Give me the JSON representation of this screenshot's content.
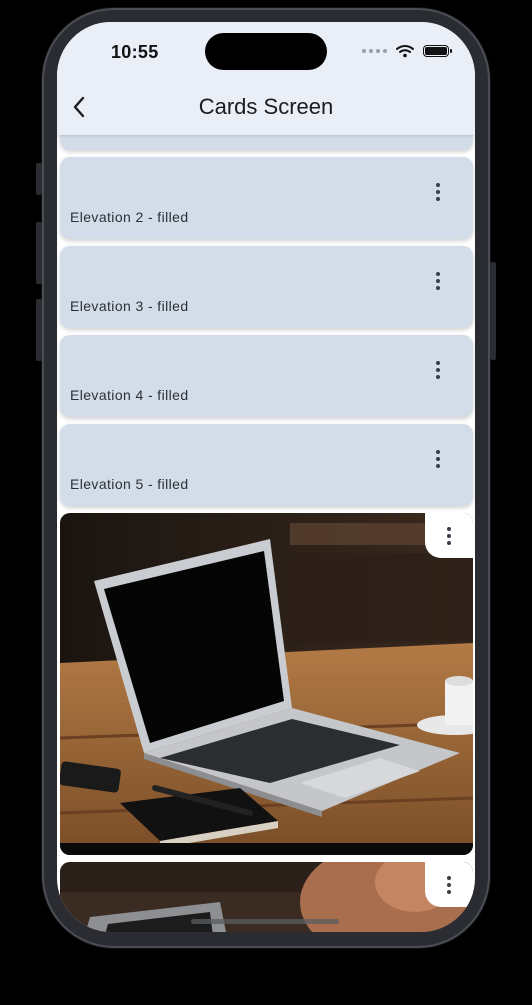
{
  "status_bar": {
    "time": "10:55"
  },
  "app_bar": {
    "title": "Cards Screen",
    "back_icon": "chevron-left-icon"
  },
  "cards": [
    {
      "label": "Elevation 2 - filled"
    },
    {
      "label": "Elevation 3 - filled"
    },
    {
      "label": "Elevation 4 - filled"
    },
    {
      "label": "Elevation 5 - filled"
    }
  ],
  "image_cards": [
    {
      "image": "laptop-on-wooden-table-photo",
      "menu_icon": "more-vert-icon"
    },
    {
      "image": "laptop-photo-partial",
      "menu_icon": "more-vert-icon"
    }
  ],
  "colors": {
    "card_fill": "#d3dde9",
    "app_bar": "#e9eef7"
  }
}
